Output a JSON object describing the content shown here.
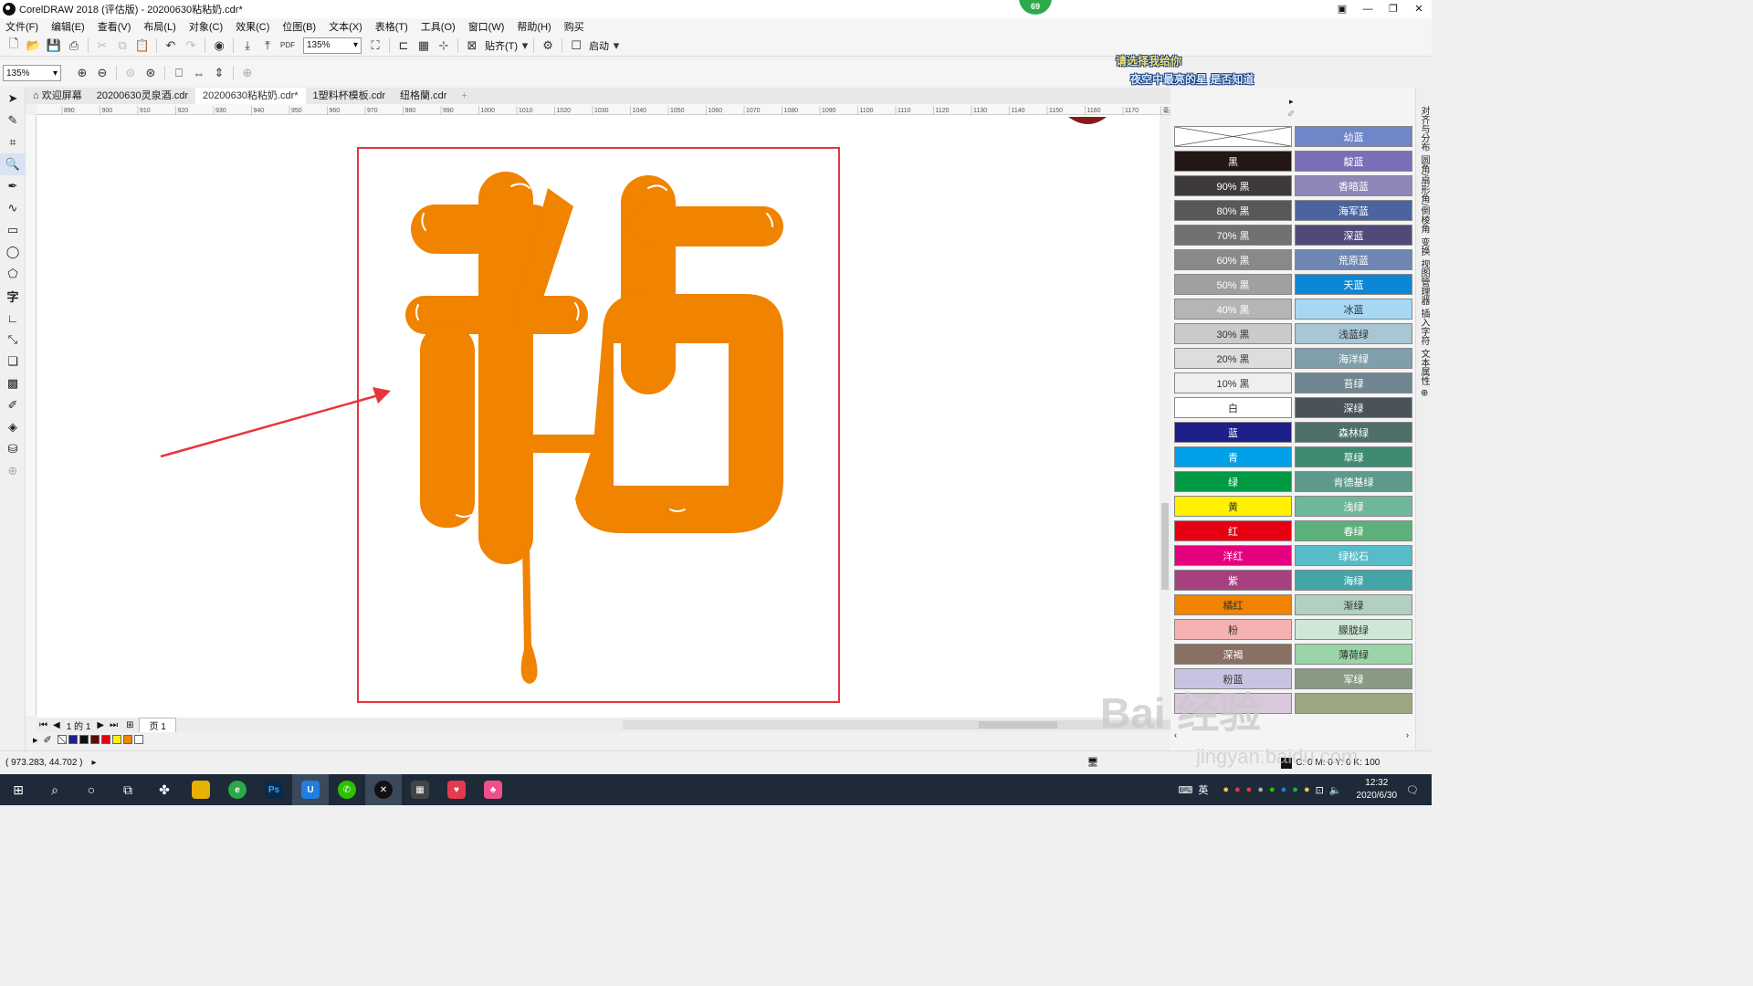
{
  "window": {
    "title": "CorelDRAW 2018 (评估版) - 20200630粘粘奶.cdr*",
    "notif_count": "69"
  },
  "menu": [
    "文件(F)",
    "编辑(E)",
    "查看(V)",
    "布局(L)",
    "对象(C)",
    "效果(C)",
    "位图(B)",
    "文本(X)",
    "表格(T)",
    "工具(O)",
    "窗口(W)",
    "帮助(H)",
    "购买"
  ],
  "toolbar": {
    "zoom": "135%",
    "snap_label": "贴齐(T)",
    "launch_label": "启动"
  },
  "toolbar2": {
    "zoom": "135%"
  },
  "promo": {
    "line1": "请选择我给你",
    "line2": "夜空中最亮的星 是否知道"
  },
  "tabs": [
    "欢迎屏幕",
    "20200630灵泉酒.cdr",
    "20200630粘粘奶.cdr*",
    "1塑料杯模板.cdr",
    "纽格蘭.cdr"
  ],
  "ruler": [
    "890",
    "900",
    "910",
    "920",
    "930",
    "940",
    "950",
    "960",
    "970",
    "980",
    "990",
    "1000",
    "1010",
    "1020",
    "1030",
    "1040",
    "1050",
    "1060",
    "1070",
    "1080",
    "1090",
    "1100",
    "1110",
    "1120",
    "1130",
    "1140",
    "1150",
    "1160",
    "1170",
    "毫米"
  ],
  "pagebar": {
    "page_of": "1 的 1",
    "page_tab": "页 1"
  },
  "status": {
    "coords": "( 973.283, 44.702 )",
    "fill_info": "C: 0 M: 0 Y: 0 K: 100"
  },
  "palette": [
    [
      "",
      "#ffffff",
      "#000000"
    ],
    [
      "幼蓝",
      "#6f87c8",
      "#ffffff"
    ],
    [
      "黑",
      "#231815",
      "#ffffff"
    ],
    [
      "靛蓝",
      "#7a6fb7",
      "#ffffff"
    ],
    [
      "90% 黑",
      "#3e3a39",
      "#ffffff"
    ],
    [
      "香暗蓝",
      "#8f86b8",
      "#ffffff"
    ],
    [
      "80% 黑",
      "#595757",
      "#ffffff"
    ],
    [
      "海军蓝",
      "#4b64a0",
      "#ffffff"
    ],
    [
      "70% 黑",
      "#727171",
      "#ffffff"
    ],
    [
      "深蓝",
      "#514a78",
      "#ffffff"
    ],
    [
      "60% 黑",
      "#898989",
      "#ffffff"
    ],
    [
      "荒原蓝",
      "#6f86b2",
      "#ffffff"
    ],
    [
      "50% 黑",
      "#9fa0a0",
      "#ffffff"
    ],
    [
      "天蓝",
      "#0b87d6",
      "#ffffff"
    ],
    [
      "40% 黑",
      "#b5b5b6",
      "#ffffff"
    ],
    [
      "冰蓝",
      "#a6d8f4",
      "#333333"
    ],
    [
      "30% 黑",
      "#c9caca",
      "#333333"
    ],
    [
      "浅蓝绿",
      "#a9c6d4",
      "#333333"
    ],
    [
      "20% 黑",
      "#dcdddd",
      "#333333"
    ],
    [
      "海洋绿",
      "#7f9fab",
      "#ffffff"
    ],
    [
      "10% 黑",
      "#efefef",
      "#333333"
    ],
    [
      "苔绿",
      "#6f8690",
      "#ffffff"
    ],
    [
      "白",
      "#ffffff",
      "#333333"
    ],
    [
      "深绿",
      "#4a5358",
      "#ffffff"
    ],
    [
      "蓝",
      "#1d2088",
      "#ffffff"
    ],
    [
      "森林绿",
      "#4e7069",
      "#ffffff"
    ],
    [
      "青",
      "#00a0e9",
      "#ffffff"
    ],
    [
      "草绿",
      "#3f8a72",
      "#ffffff"
    ],
    [
      "绿",
      "#009944",
      "#ffffff"
    ],
    [
      "肯德基绿",
      "#5e9a8c",
      "#ffffff"
    ],
    [
      "黄",
      "#fff100",
      "#333333"
    ],
    [
      "浅绿",
      "#6fb79b",
      "#ffffff"
    ],
    [
      "红",
      "#e60012",
      "#ffffff"
    ],
    [
      "春绿",
      "#5cb07a",
      "#ffffff"
    ],
    [
      "洋红",
      "#e4007f",
      "#ffffff"
    ],
    [
      "绿松石",
      "#58bcc8",
      "#ffffff"
    ],
    [
      "紫",
      "#a7407f",
      "#ffffff"
    ],
    [
      "海绿",
      "#45a4a8",
      "#ffffff"
    ],
    [
      "橘红",
      "#f08300",
      "#333333"
    ],
    [
      "渐绿",
      "#b3cfc0",
      "#333333"
    ],
    [
      "粉",
      "#f5b2b2",
      "#333333"
    ],
    [
      "朦胧绿",
      "#cfe8d6",
      "#333333"
    ],
    [
      "深褐",
      "#8a6f63",
      "#ffffff"
    ],
    [
      "薄荷绿",
      "#99d5a8",
      "#333333"
    ],
    [
      "粉蓝",
      "#c9c3e3",
      "#333333"
    ],
    [
      "军绿",
      "#889a82",
      "#ffffff"
    ],
    [
      "",
      "#d9c8dc",
      "#333333"
    ],
    [
      "",
      "#9da882",
      "#333333"
    ]
  ],
  "dock_labels": [
    "对齐与分布",
    "圆角/扇形角/倒棱角",
    "变换",
    "视图管理器",
    "插入字符",
    "文本属性"
  ],
  "canvas": {
    "fill_color": "#f08300",
    "frame_color": "#e8343c",
    "arrow_color": "#e8343c"
  },
  "taskbar": {
    "time": "12:32",
    "date": "2020/6/30",
    "ime": "英"
  },
  "watermark": {
    "main": "Bai 经验",
    "sub": "jingyan.baidu.com"
  }
}
